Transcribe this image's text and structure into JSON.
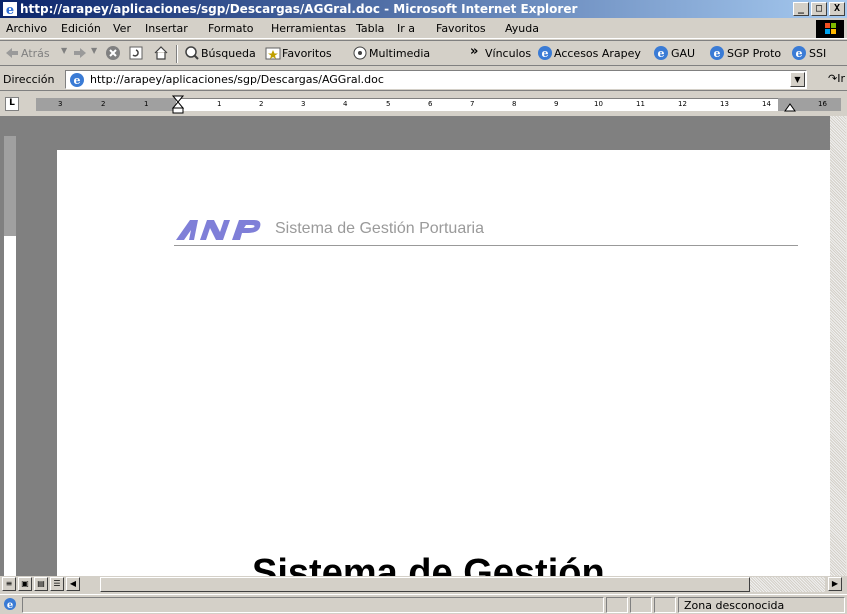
{
  "window": {
    "title": "http://arapey/aplicaciones/sgp/Descargas/AGGral.doc - Microsoft Internet Explorer",
    "minimize": "_",
    "maximize": "□",
    "close": "X"
  },
  "menu": [
    "Archivo",
    "Edición",
    "Ver",
    "Insertar",
    "Formato",
    "Herramientas",
    "Tabla",
    "Ir a",
    "Favoritos",
    "Ayuda"
  ],
  "toolbar": {
    "back": "Atrás",
    "search": "Búsqueda",
    "favorites": "Favoritos",
    "multimedia": "Multimedia",
    "chevron": "»",
    "links_label": "Vínculos",
    "links": [
      "Accesos Arapey",
      "GAU",
      "SGP Proto",
      "SSI"
    ]
  },
  "address": {
    "label": "Dirección",
    "value": "http://arapey/aplicaciones/sgp/Descargas/AGGral.doc",
    "go": "Ir"
  },
  "ruler": {
    "corner": "L",
    "left_ticks": [
      "3",
      "2",
      "1"
    ],
    "right_ticks": [
      "1",
      "2",
      "3",
      "4",
      "5",
      "6",
      "7",
      "8",
      "9",
      "10",
      "11",
      "12",
      "13",
      "14",
      "16"
    ]
  },
  "document": {
    "logo_text": "ANP",
    "header_text": "Sistema de Gestión Portuaria",
    "title_partial": "Sistema de Gestión"
  },
  "status": {
    "zone": "Zona desconocida"
  },
  "colors": {
    "titlebar_start": "#0a246a",
    "titlebar_end": "#a6caf0",
    "logo": "#7f7fd8"
  }
}
